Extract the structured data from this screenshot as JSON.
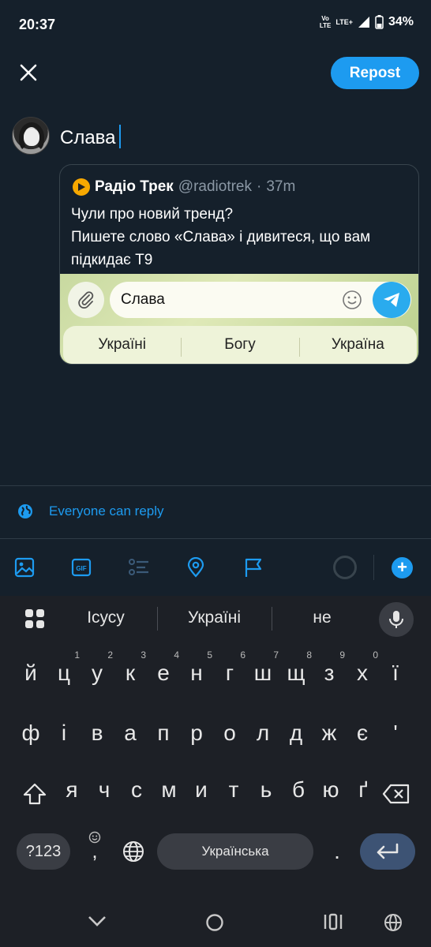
{
  "status_bar": {
    "time": "20:37",
    "volte_top": "Vo",
    "volte_bottom": "LTE",
    "network": "LTE+",
    "battery": "34%"
  },
  "header": {
    "repost_label": "Repost"
  },
  "compose": {
    "text": "Слава"
  },
  "quoted_tweet": {
    "name": "Радіо Трек",
    "handle": "@radiotrek",
    "separator": "·",
    "age": "37m",
    "line1": "Чули про новий тренд?",
    "line2": "Пишете слово «Слава» і дивитеся, що вам підкидає Т9",
    "image": {
      "input_text": "Слава",
      "suggestions": [
        "Україні",
        "Богу",
        "Україна"
      ]
    }
  },
  "reply_setting": {
    "label": "Everyone can reply"
  },
  "toolbar": {
    "icons": [
      "image-icon",
      "gif-icon",
      "poll-icon",
      "location-icon",
      "flag-icon"
    ],
    "accent": "#1d9bf0"
  },
  "keyboard": {
    "suggestions": [
      "Ісусу",
      "Україні",
      "не"
    ],
    "row1": [
      "й",
      "ц",
      "у",
      "к",
      "е",
      "н",
      "г",
      "ш",
      "щ",
      "з",
      "х",
      "ї"
    ],
    "row1_hints": [
      "",
      "1",
      "2",
      "3",
      "4",
      "5",
      "6",
      "7",
      "8",
      "9",
      "0",
      ""
    ],
    "row2": [
      "ф",
      "і",
      "в",
      "а",
      "п",
      "р",
      "о",
      "л",
      "д",
      "ж",
      "є",
      "'"
    ],
    "row3": [
      "я",
      "ч",
      "с",
      "м",
      "и",
      "т",
      "ь",
      "б",
      "ю",
      "ґ"
    ],
    "symbols_label": "?123",
    "comma": ",",
    "space_label": "Українська",
    "period": "."
  }
}
